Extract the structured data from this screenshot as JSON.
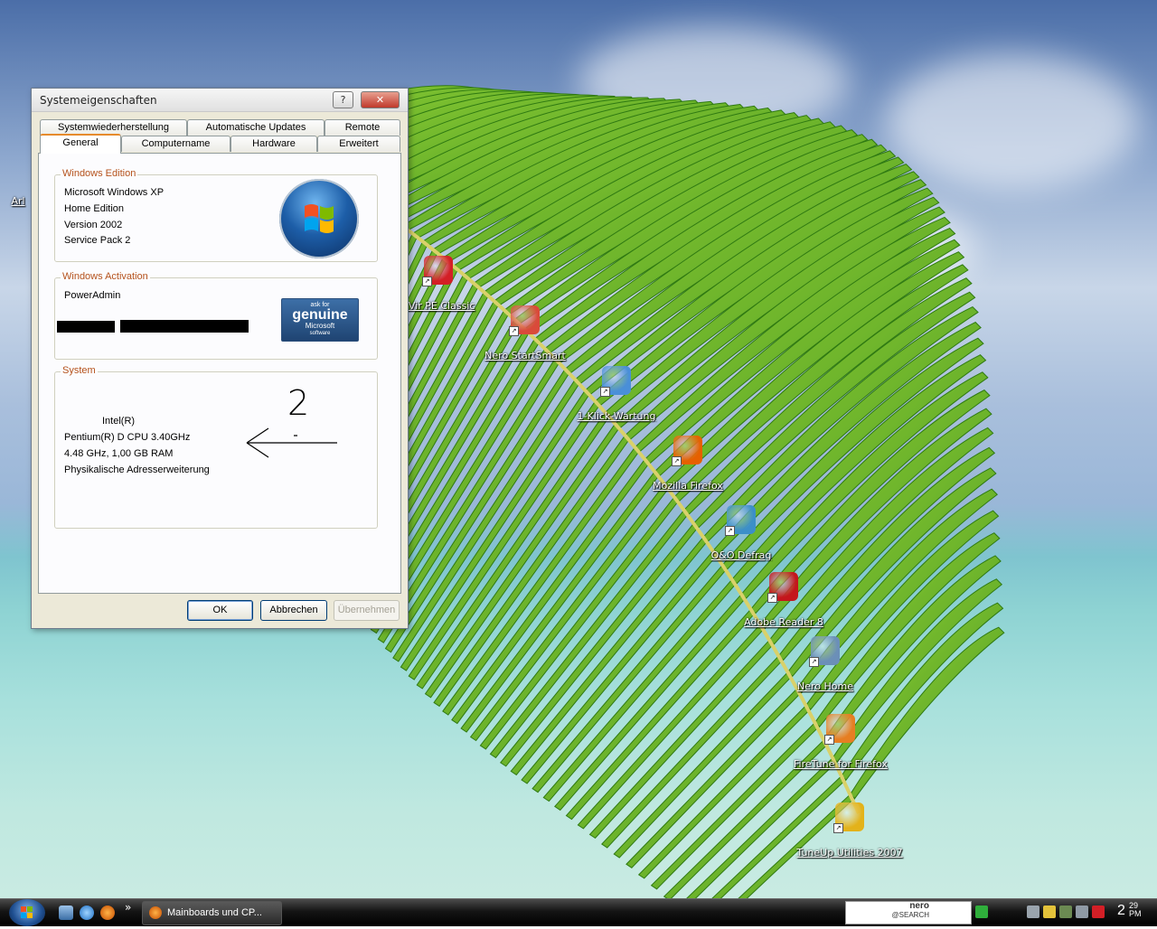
{
  "dialog": {
    "title": "Systemeigenschaften",
    "help_button": "?",
    "close_button": "✕",
    "tabs_back": [
      "Systemwiederherstellung",
      "Automatische Updates",
      "Remote"
    ],
    "tabs_front": [
      "General",
      "Computername",
      "Hardware",
      "Erweitert"
    ],
    "active_tab": "General",
    "edition": {
      "legend": "Windows Edition",
      "lines": [
        "Microsoft Windows XP",
        "Home Edition",
        "Version 2002",
        "Service Pack 2"
      ]
    },
    "activation": {
      "legend": "Windows Activation",
      "user": "PowerAdmin",
      "genuine_badge": {
        "line1": "ask for",
        "line2": "genuine",
        "line3": "Microsoft",
        "line4": "software"
      }
    },
    "system": {
      "legend": "System",
      "cpu_vendor": "Intel(R)",
      "lines": [
        "Pentium(R) D CPU 3.40GHz",
        "4.48 GHz, 1,00 GB RAM",
        "Physikalische Adresserweiterung"
      ],
      "annotation_number": "2"
    },
    "buttons": {
      "ok": "OK",
      "cancel": "Abbrechen",
      "apply": "Übernehmen"
    }
  },
  "desktop_icons": [
    {
      "label": "tiVir PE Classic",
      "color": "#d31f26",
      "icon": "antivir-icon"
    },
    {
      "label": "Nero StartSmart",
      "color": "#d94a3a",
      "icon": "nero-startsmart-icon"
    },
    {
      "label": "1-Klick-Wartung",
      "color": "#4a8fd8",
      "icon": "tuneup-1click-icon"
    },
    {
      "label": "Mozilla Firefox",
      "color": "#e66000",
      "icon": "firefox-icon"
    },
    {
      "label": "O&O Defrag",
      "color": "#3c8fc8",
      "icon": "defrag-icon"
    },
    {
      "label": "Adobe Reader 8",
      "color": "#c4161c",
      "icon": "adobe-reader-icon"
    },
    {
      "label": "Nero Home",
      "color": "#6b8fb8",
      "icon": "nero-home-icon"
    },
    {
      "label": "FireTune for Firefox",
      "color": "#e67e22",
      "icon": "firetune-icon"
    },
    {
      "label": "TuneUp Utilities 2007",
      "color": "#e3b21a",
      "icon": "tuneup-icon"
    },
    {
      "label": "Arl",
      "color": "#000000",
      "icon": "partial-icon"
    }
  ],
  "taskbar": {
    "task_label": "Mainboards und CP...",
    "quicklaunch_more": "»",
    "nero_search": {
      "brand": "nero",
      "sub": "@SEARCH"
    },
    "clock": {
      "hour": "2",
      "minute": "29",
      "ampm": "PM"
    }
  }
}
